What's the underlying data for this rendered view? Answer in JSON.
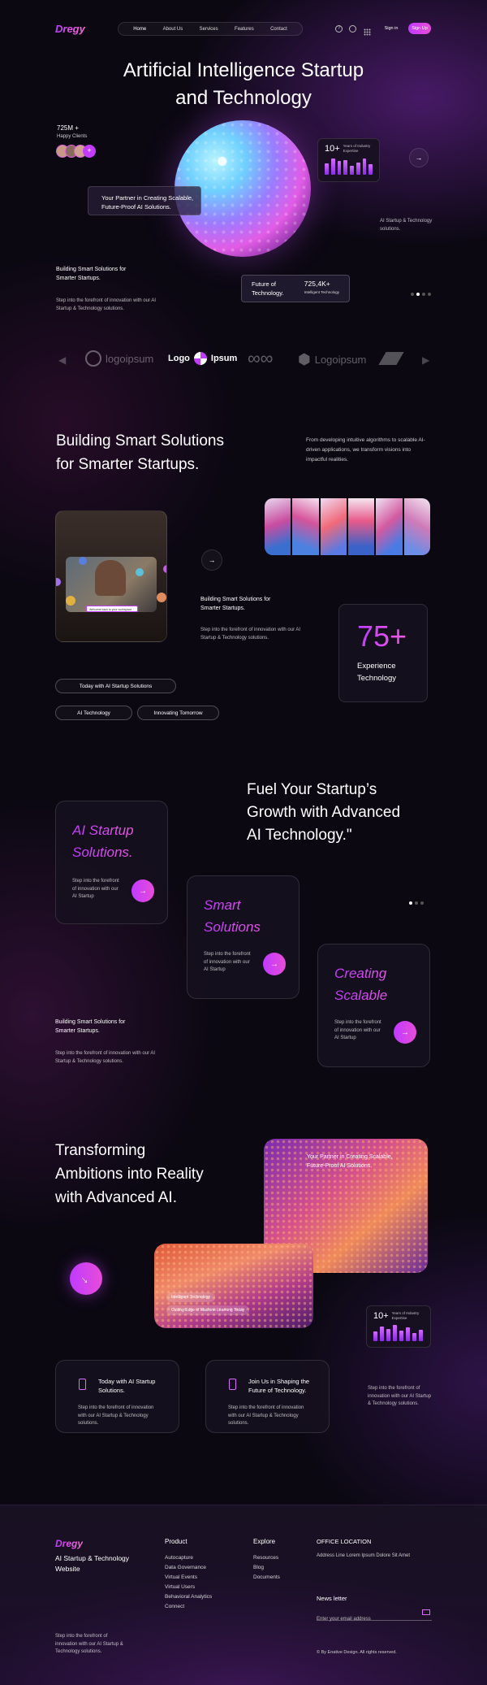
{
  "brand": "Dregy",
  "nav": {
    "items": [
      "Home",
      "About Us",
      "Services",
      "Features",
      "Contact"
    ],
    "signin": "Sign in",
    "signup": "Sign Up"
  },
  "hero": {
    "title_line1": "Artificial Intelligence Startup",
    "title_line2": "and Technology",
    "clients_count": "725M +",
    "clients_label": "Happy Clients",
    "partner_line1": "Your Partner in Creating Scalable,",
    "partner_line2": "Future-Proof AI Solutions.",
    "years_value": "10+",
    "years_label": "Years of Industry Expertise",
    "side_text": "AI Startup & Technology solutions.",
    "building_line1": "Building Smart Solutions for",
    "building_line2": "Smarter Startups.",
    "desc": "Step into the forefront of innovation with our AI Startup & Technology solutions.",
    "future_line1": "Future of",
    "future_line2": "Technology.",
    "future_value": "725,4K+",
    "future_label": "Intelligent Technology"
  },
  "logos": [
    "logoipsum",
    "Logo",
    "Ipsum",
    "Logoipsum"
  ],
  "solutions": {
    "title_line1": "Building Smart Solutions",
    "title_line2": "for Smarter Startups.",
    "desc": "From developing intuitive algorithms to scalable AI-driven applications, we transform visions into impactful realities.",
    "video_overlay": "Welcome back to your workspace",
    "sub_line1": "Building Smart Solutions for",
    "sub_line2": "Smarter Startups.",
    "sub_desc": "Step into the forefront of innovation with our AI Startup & Technology solutions.",
    "exp_value": "75+",
    "exp_line1": "Experience",
    "exp_line2": "Technology",
    "tags": [
      "Today with AI Startup Solutions",
      "AI Technology",
      "Innovating Tomorrow"
    ]
  },
  "fuel": {
    "title_line1": "Fuel Your Startup’s",
    "title_line2": "Growth with Advanced",
    "title_line3": "AI Technology.\"",
    "cards": [
      {
        "line1": "AI Startup",
        "line2": "Solutions.",
        "desc": "Step into the forefront of innovation with our AI Startup"
      },
      {
        "line1": "Smart",
        "line2": "Solutions",
        "desc": "Step into the forefront of innovation with our AI Startup"
      },
      {
        "line1": "Creating",
        "line2": "Scalable",
        "desc": "Step into the forefront of innovation with our AI Startup"
      }
    ],
    "side_line1": "Building Smart Solutions for",
    "side_line2": "Smarter Startups.",
    "side_desc": "Step into the forefront of innovation with our AI Startup & Technology solutions."
  },
  "transform": {
    "title_line1": "Transforming",
    "title_line2": "Ambitions into Reality",
    "title_line3": "with Advanced AI.",
    "img_line1": "Your Partner in Creating Scalable,",
    "img_line2": "Future-Proof AI Solutions.",
    "chip1": "Intelligent Technology",
    "chip2": "Cutting Edge of Machine Learning Today",
    "years_value": "10+",
    "years_label": "Years of Industry Expertise",
    "card1_line1": "Today with AI Startup",
    "card1_line2": "Solutions.",
    "card1_desc": "Step into the forefront of innovation with our AI Startup & Technology solutions.",
    "card2_line1": "Join Us in Shaping the",
    "card2_line2": "Future of Technology.",
    "card2_desc": "Step into the forefront of innovation with our AI Startup & Technology solutions.",
    "side_desc": "Step into the forefront of innovation with our AI Startup & Technology solutions."
  },
  "footer": {
    "brand": "Dregy",
    "tagline_line1": "AI Startup & Technology",
    "tagline_line2": "Website",
    "desc": "Step into the forefront of innovation with our AI Startup & Technology solutions.",
    "product_title": "Product",
    "product_links": [
      "Autocapture",
      "Data Governance",
      "Virtual Events",
      "Virtual Users",
      "Behavioral Analytics",
      "Connect"
    ],
    "explore_title": "Explore",
    "explore_links": [
      "Resources",
      "Blog",
      "Documents"
    ],
    "office_title": "OFFICE LOCATION",
    "office_address": "Address Line Lorem Ipsum Dolore Sit Amet",
    "newsletter_title": "News letter",
    "newsletter_placeholder": "Enter your email address",
    "copyright": "© By Enative Design. All rights reserved."
  },
  "colors": {
    "accent": "#c13cff",
    "bg": "#0b0812"
  }
}
